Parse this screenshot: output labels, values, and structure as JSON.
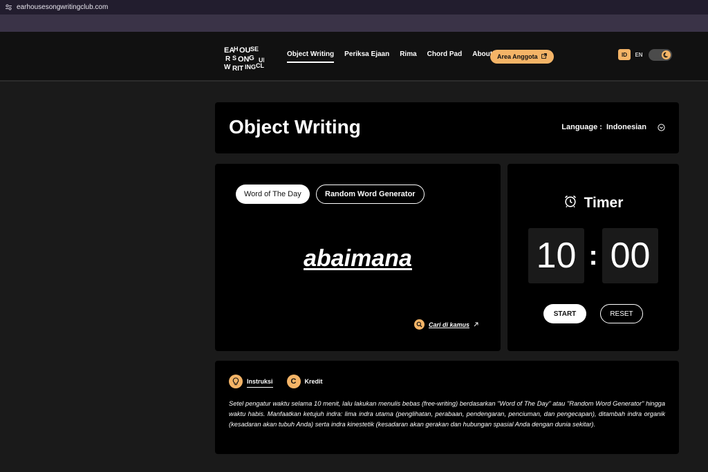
{
  "browser": {
    "url": "earhousesongwritingclub.com"
  },
  "header": {
    "logo_text": "EARHOUSE SONGWRITING CLUB",
    "nav": [
      {
        "label": "Object Writing",
        "active": true
      },
      {
        "label": "Periksa Ejaan",
        "active": false
      },
      {
        "label": "Rima",
        "active": false
      },
      {
        "label": "Chord Pad",
        "active": false
      },
      {
        "label": "About",
        "active": false
      }
    ],
    "member_button": "Area Anggota",
    "lang_id": "ID",
    "lang_en": "EN",
    "dark_mode": true
  },
  "title_card": {
    "title": "Object Writing",
    "language_label": "Language :",
    "language_value": "Indonesian"
  },
  "word_card": {
    "tab_day": "Word of The Day",
    "tab_random": "Random Word Generator",
    "word": "abaimana",
    "dict_link": "Cari di kamus"
  },
  "timer": {
    "title": "Timer",
    "minutes": "10",
    "colon": ":",
    "seconds": "00",
    "start": "START",
    "reset": "RESET"
  },
  "info": {
    "tab_instruksi": "Instruksi",
    "tab_kredit": "Kredit",
    "kredit_letter": "C",
    "text": "Setel pengatur waktu selama 10 menit, lalu lakukan menulis bebas (free-writing) berdasarkan \"Word of The Day\" atau \"Random Word Generator\" hingga waktu habis. Manfaatkan ketujuh indra: lima indra utama (penglihatan, perabaan, pendengaran, penciuman, dan pengecapan), ditambah indra organik (kesadaran akan tubuh Anda) serta indra kinestetik (kesadaran akan gerakan dan hubungan spasial Anda dengan dunia sekitar)."
  },
  "colors": {
    "accent": "#f4b467",
    "card": "#000000",
    "page": "#1a1a1a"
  }
}
